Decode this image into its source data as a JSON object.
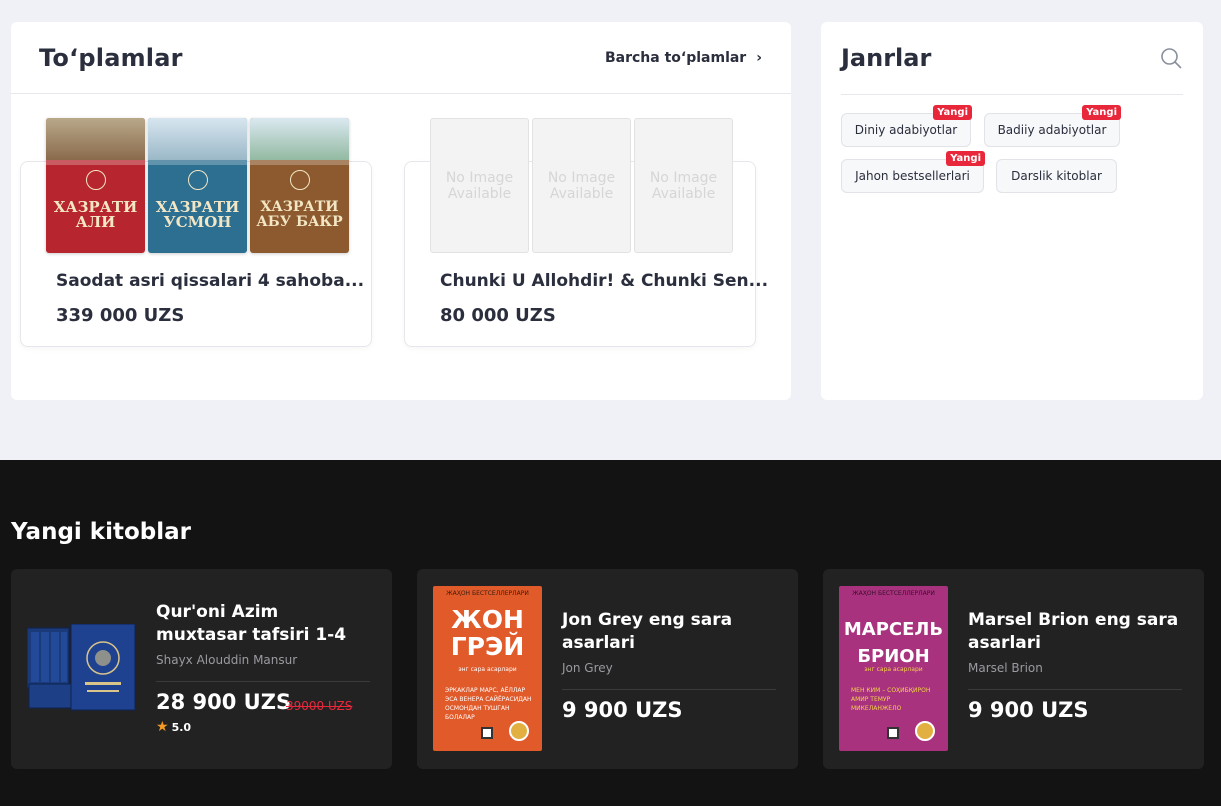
{
  "collections": {
    "title": "To‘plamlar",
    "see_all": "Barcha to‘plamlar",
    "items": [
      {
        "name": "Saodat asri qissalari 4 sahoba...",
        "price": "339 000 UZS",
        "covers": [
          "ХАЗРАТИ АЛИ",
          "ХАЗРАТИ УСМОН",
          "ХАЗРАТИ АБУ БАКР"
        ]
      },
      {
        "name": "Chunki U Allohdir! & Chunki Sen...",
        "price": "80 000 UZS",
        "no_image": "No Image Available"
      }
    ]
  },
  "genres": {
    "title": "Janrlar",
    "chips": [
      {
        "label": "Diniy adabiyotlar",
        "badge": "Yangi"
      },
      {
        "label": "Badiiy adabiyotlar",
        "badge": "Yangi"
      },
      {
        "label": "Jahon bestsellerlari",
        "badge": "Yangi"
      },
      {
        "label": "Darslik kitoblar",
        "badge": ""
      }
    ]
  },
  "new_books": {
    "title": "Yangi kitoblar",
    "items": [
      {
        "name": "Qur'oni Azim muxtasar tafsiri 1-4",
        "author": "Shayx Alouddin Mansur",
        "price": "28 900 UZS",
        "old_price": "39000 UZS",
        "rating": "5.0"
      },
      {
        "name": "Jon Grey eng sara asarlari",
        "author": "Jon Grey",
        "price": "9 900 UZS",
        "cover_series": "ЖАҲОН БЕСТСЕЛЛЕРЛАРИ",
        "cover_title": "ЖОН ГРЭЙ",
        "cover_sub": "энг сара асарлари",
        "cover_list": [
          "ЭРКАКЛАР МАРС, АЁЛЛАР",
          "ЭСА ВЕНЕРА САЙЁРАСИДАН",
          "ОСМОНДАН ТУШГАН БОЛАЛАР"
        ]
      },
      {
        "name": "Marsel Brion eng sara asarlari",
        "author": "Marsel Brion",
        "price": "9 900 UZS",
        "cover_series": "ЖАҲОН БЕСТСЕЛЛЕРЛАРИ",
        "cover_title": "МАРСЕЛЬ БРИОН",
        "cover_sub": "энг сара асарлари",
        "cover_list": [
          "МЕН КИМ – СОҲИБҚИРОН",
          "АМИР ТЕМУР",
          "МИКЕЛАНЖЕЛО"
        ]
      }
    ]
  },
  "colors": {
    "page_bg": "#f0f1f6",
    "dark_bg": "#141314",
    "card_dark": "#222223",
    "badge_red": "#e8283a",
    "star": "#f59a23"
  }
}
